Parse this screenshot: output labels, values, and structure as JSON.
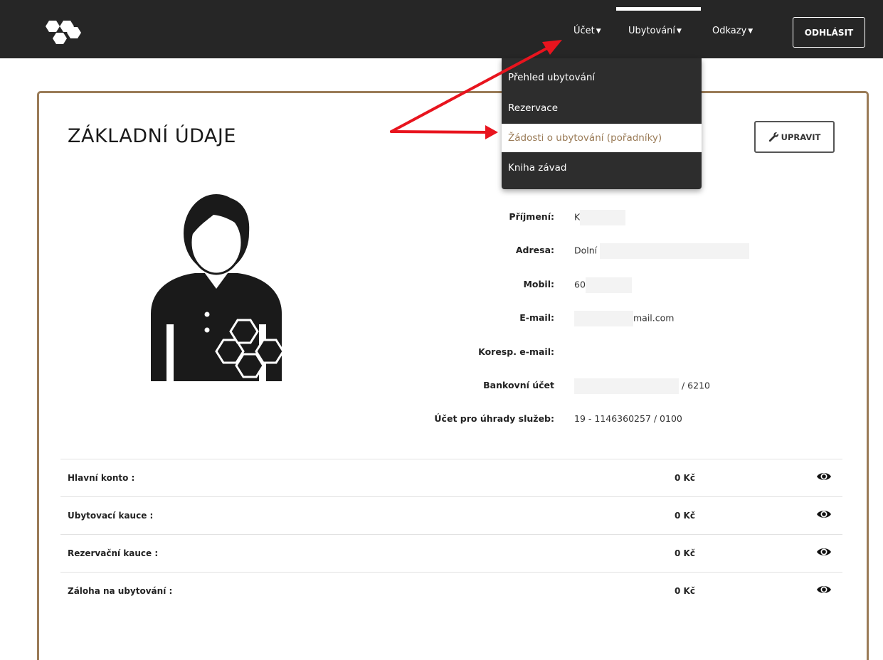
{
  "nav": {
    "account": "Účet",
    "accommodation": "Ubytování",
    "links": "Odkazy",
    "logout": "ODHLÁSIT"
  },
  "dropdown": {
    "items": [
      {
        "label": "Přehled ubytování"
      },
      {
        "label": "Rezervace"
      },
      {
        "label": "Žádosti o ubytování (pořadníky)"
      },
      {
        "label": "Kniha závad"
      }
    ],
    "active_index": 2
  },
  "page": {
    "title": "ZÁKLADNÍ ÚDAJE",
    "edit_button": "UPRAVIT"
  },
  "profile": {
    "surname_label": "Příjmení:",
    "surname_value": "K",
    "address_label": "Adresa:",
    "address_value": "Dolní",
    "mobile_label": "Mobil:",
    "mobile_value": "60",
    "email_label": "E-mail:",
    "email_value": "mail.com",
    "corr_email_label": "Koresp. e-mail:",
    "bank_label": "Bankovní účet",
    "bank_value": "/ 6210",
    "services_label": "Účet pro úhrady služeb:",
    "services_value": "19 - 1146360257 / 0100"
  },
  "ledger": [
    {
      "name": "Hlavní konto :",
      "amount": "0 Kč"
    },
    {
      "name": "Ubytovací kauce :",
      "amount": "0 Kč"
    },
    {
      "name": "Rezervační kauce :",
      "amount": "0 Kč"
    },
    {
      "name": "Záloha na ubytování :",
      "amount": "0 Kč"
    }
  ],
  "colors": {
    "navbar": "#262626",
    "accent": "#9a7b57",
    "annotation": "#e8141e"
  },
  "icons": [
    "honeycomb-logo-icon",
    "caret-down-icon",
    "wrench-icon",
    "user-avatar-icon",
    "eye-icon"
  ]
}
